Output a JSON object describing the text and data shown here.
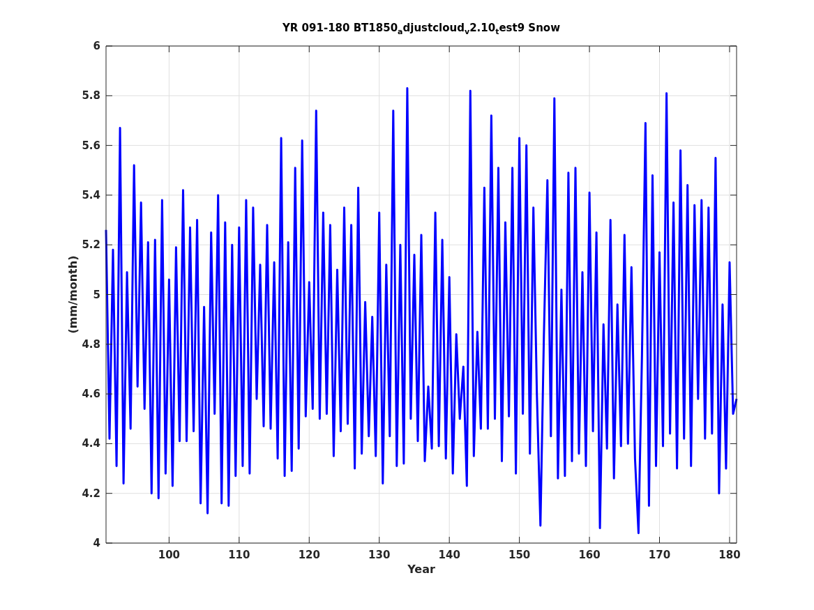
{
  "chart_data": {
    "type": "line",
    "title": "YR 091-180 BT1850$_{a}$djustcloud$_{v}$2.10$_{t}$est9 Snow",
    "xlabel": "Year",
    "ylabel": "(mm/month)",
    "grid": true,
    "xlim": [
      91,
      181
    ],
    "ylim": [
      4,
      6
    ],
    "xticks": [
      100,
      110,
      120,
      130,
      140,
      150,
      160,
      170,
      180
    ],
    "yticks": [
      4,
      4.2,
      4.4,
      4.6,
      4.8,
      {
        "value": 5,
        "label": "5"
      },
      5.2,
      5.4,
      5.6,
      5.8,
      {
        "value": 6,
        "label": "6"
      }
    ],
    "x": [
      91,
      91.5,
      92,
      92.5,
      93,
      93.5,
      94,
      94.5,
      95,
      95.5,
      96,
      96.5,
      97,
      97.5,
      98,
      98.5,
      99,
      99.5,
      100,
      100.5,
      101,
      101.5,
      102,
      102.5,
      103,
      103.5,
      104,
      104.5,
      105,
      105.5,
      106,
      106.5,
      107,
      107.5,
      108,
      108.5,
      109,
      109.5,
      110,
      110.5,
      111,
      111.5,
      112,
      112.5,
      113,
      113.5,
      114,
      114.5,
      115,
      115.5,
      116,
      116.5,
      117,
      117.5,
      118,
      118.5,
      119,
      119.5,
      120,
      120.5,
      121,
      121.5,
      122,
      122.5,
      123,
      123.5,
      124,
      124.5,
      125,
      125.5,
      126,
      126.5,
      127,
      127.5,
      128,
      128.5,
      129,
      129.5,
      130,
      130.5,
      131,
      131.5,
      132,
      132.5,
      133,
      133.5,
      134,
      134.5,
      135,
      135.5,
      136,
      136.5,
      137,
      137.5,
      138,
      138.5,
      139,
      139.5,
      140,
      140.5,
      141,
      141.5,
      142,
      142.5,
      143,
      143.5,
      144,
      144.5,
      145,
      145.5,
      146,
      146.5,
      147,
      147.5,
      148,
      148.5,
      149,
      149.5,
      150,
      150.5,
      151,
      151.5,
      152,
      152.5,
      153,
      153.5,
      154,
      154.5,
      155,
      155.5,
      156,
      156.5,
      157,
      157.5,
      158,
      158.5,
      159,
      159.5,
      160,
      160.5,
      161,
      161.5,
      162,
      162.5,
      163,
      163.5,
      164,
      164.5,
      165,
      165.5,
      166,
      166.5,
      167,
      167.5,
      168,
      168.5,
      169,
      169.5,
      170,
      170.5,
      171,
      171.5,
      172,
      172.5,
      173,
      173.5,
      174,
      174.5,
      175,
      175.5,
      176,
      176.5,
      177,
      177.5,
      178,
      178.5,
      179,
      179.5,
      180,
      180.5,
      181
    ],
    "series": [
      {
        "color": "#0000ff",
        "values": [
          5.26,
          4.42,
          5.18,
          4.31,
          5.67,
          4.24,
          5.09,
          4.46,
          5.52,
          4.63,
          5.37,
          4.54,
          5.21,
          4.2,
          5.22,
          4.18,
          5.38,
          4.28,
          5.06,
          4.23,
          5.19,
          4.41,
          5.42,
          4.41,
          5.27,
          4.45,
          5.3,
          4.16,
          4.95,
          4.12,
          5.25,
          4.52,
          5.4,
          4.16,
          5.29,
          4.15,
          5.2,
          4.27,
          5.27,
          4.31,
          5.38,
          4.28,
          5.35,
          4.58,
          5.12,
          4.47,
          5.28,
          4.46,
          5.13,
          4.34,
          5.63,
          4.27,
          5.21,
          4.29,
          5.51,
          4.38,
          5.62,
          4.51,
          5.05,
          4.54,
          5.74,
          4.5,
          5.33,
          4.52,
          5.28,
          4.35,
          5.1,
          4.45,
          5.35,
          4.48,
          5.28,
          4.3,
          5.43,
          4.36,
          4.97,
          4.43,
          4.91,
          4.35,
          5.33,
          4.24,
          5.12,
          4.43,
          5.74,
          4.31,
          5.2,
          4.32,
          5.83,
          4.5,
          5.16,
          4.41,
          5.24,
          4.33,
          4.63,
          4.38,
          5.33,
          4.39,
          5.22,
          4.34,
          5.07,
          4.28,
          4.84,
          4.5,
          4.71,
          4.23,
          5.82,
          4.35,
          4.85,
          4.46,
          5.43,
          4.46,
          5.72,
          4.5,
          5.51,
          4.33,
          5.29,
          4.51,
          5.51,
          4.28,
          5.63,
          4.52,
          5.6,
          4.36,
          5.35,
          4.6,
          4.07,
          4.84,
          5.46,
          4.43,
          5.79,
          4.26,
          5.02,
          4.27,
          5.49,
          4.33,
          5.51,
          4.36,
          5.09,
          4.31,
          5.41,
          4.45,
          5.25,
          4.06,
          4.88,
          4.38,
          5.3,
          4.26,
          4.96,
          4.39,
          5.24,
          4.4,
          5.11,
          4.34,
          4.04,
          4.76,
          5.69,
          4.15,
          5.48,
          4.31,
          5.17,
          4.39,
          5.81,
          4.44,
          5.37,
          4.3,
          5.58,
          4.42,
          5.44,
          4.31,
          5.36,
          4.58,
          5.38,
          4.42,
          5.35,
          4.44,
          5.55,
          4.2,
          4.96,
          4.3,
          5.13,
          4.52,
          4.58
        ]
      }
    ]
  }
}
